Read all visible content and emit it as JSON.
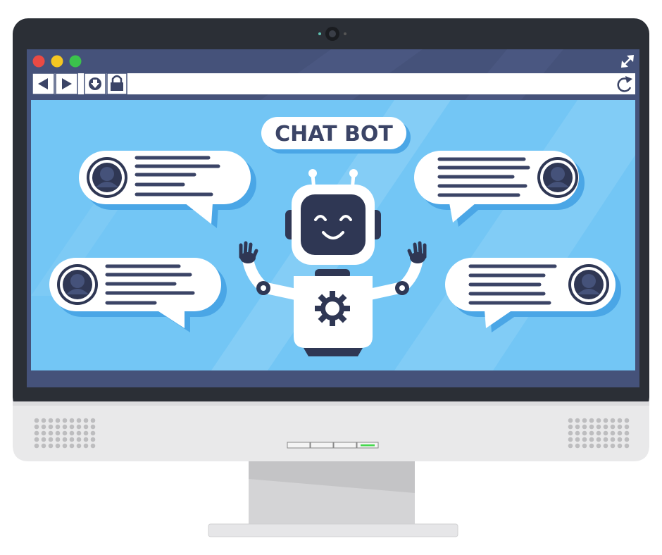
{
  "colors": {
    "monitor_frame": "#2b2f36",
    "bezel": "#3a3e47",
    "browser_bar": "#45527a",
    "screen_bg": "#73c6f5",
    "screen_light": "#9fd9f8",
    "bubble": "#ffffff",
    "bubble_shadow": "#4aa6e6",
    "text_lines": "#3b4466",
    "chin": "#e9e9ea",
    "stand": "#d4d4d6",
    "led_on": "#41d84a"
  },
  "window_controls": [
    "close",
    "minimize",
    "maximize"
  ],
  "toolbar_icons": [
    "back-arrow-icon",
    "forward-arrow-icon",
    "download-icon",
    "lock-icon",
    "refresh-icon",
    "fullscreen-icon"
  ],
  "banner": {
    "title": "CHAT BOT"
  },
  "bubbles": [
    {
      "side": "left",
      "position": "top-left",
      "icon": "user-avatar-icon"
    },
    {
      "side": "right",
      "position": "top-right",
      "icon": "user-avatar-icon"
    },
    {
      "side": "left",
      "position": "bottom-left",
      "icon": "user-avatar-icon"
    },
    {
      "side": "right",
      "position": "bottom-right",
      "icon": "user-avatar-icon"
    }
  ],
  "robot": {
    "chest_icon": "gear-icon",
    "expression": "smiling"
  }
}
